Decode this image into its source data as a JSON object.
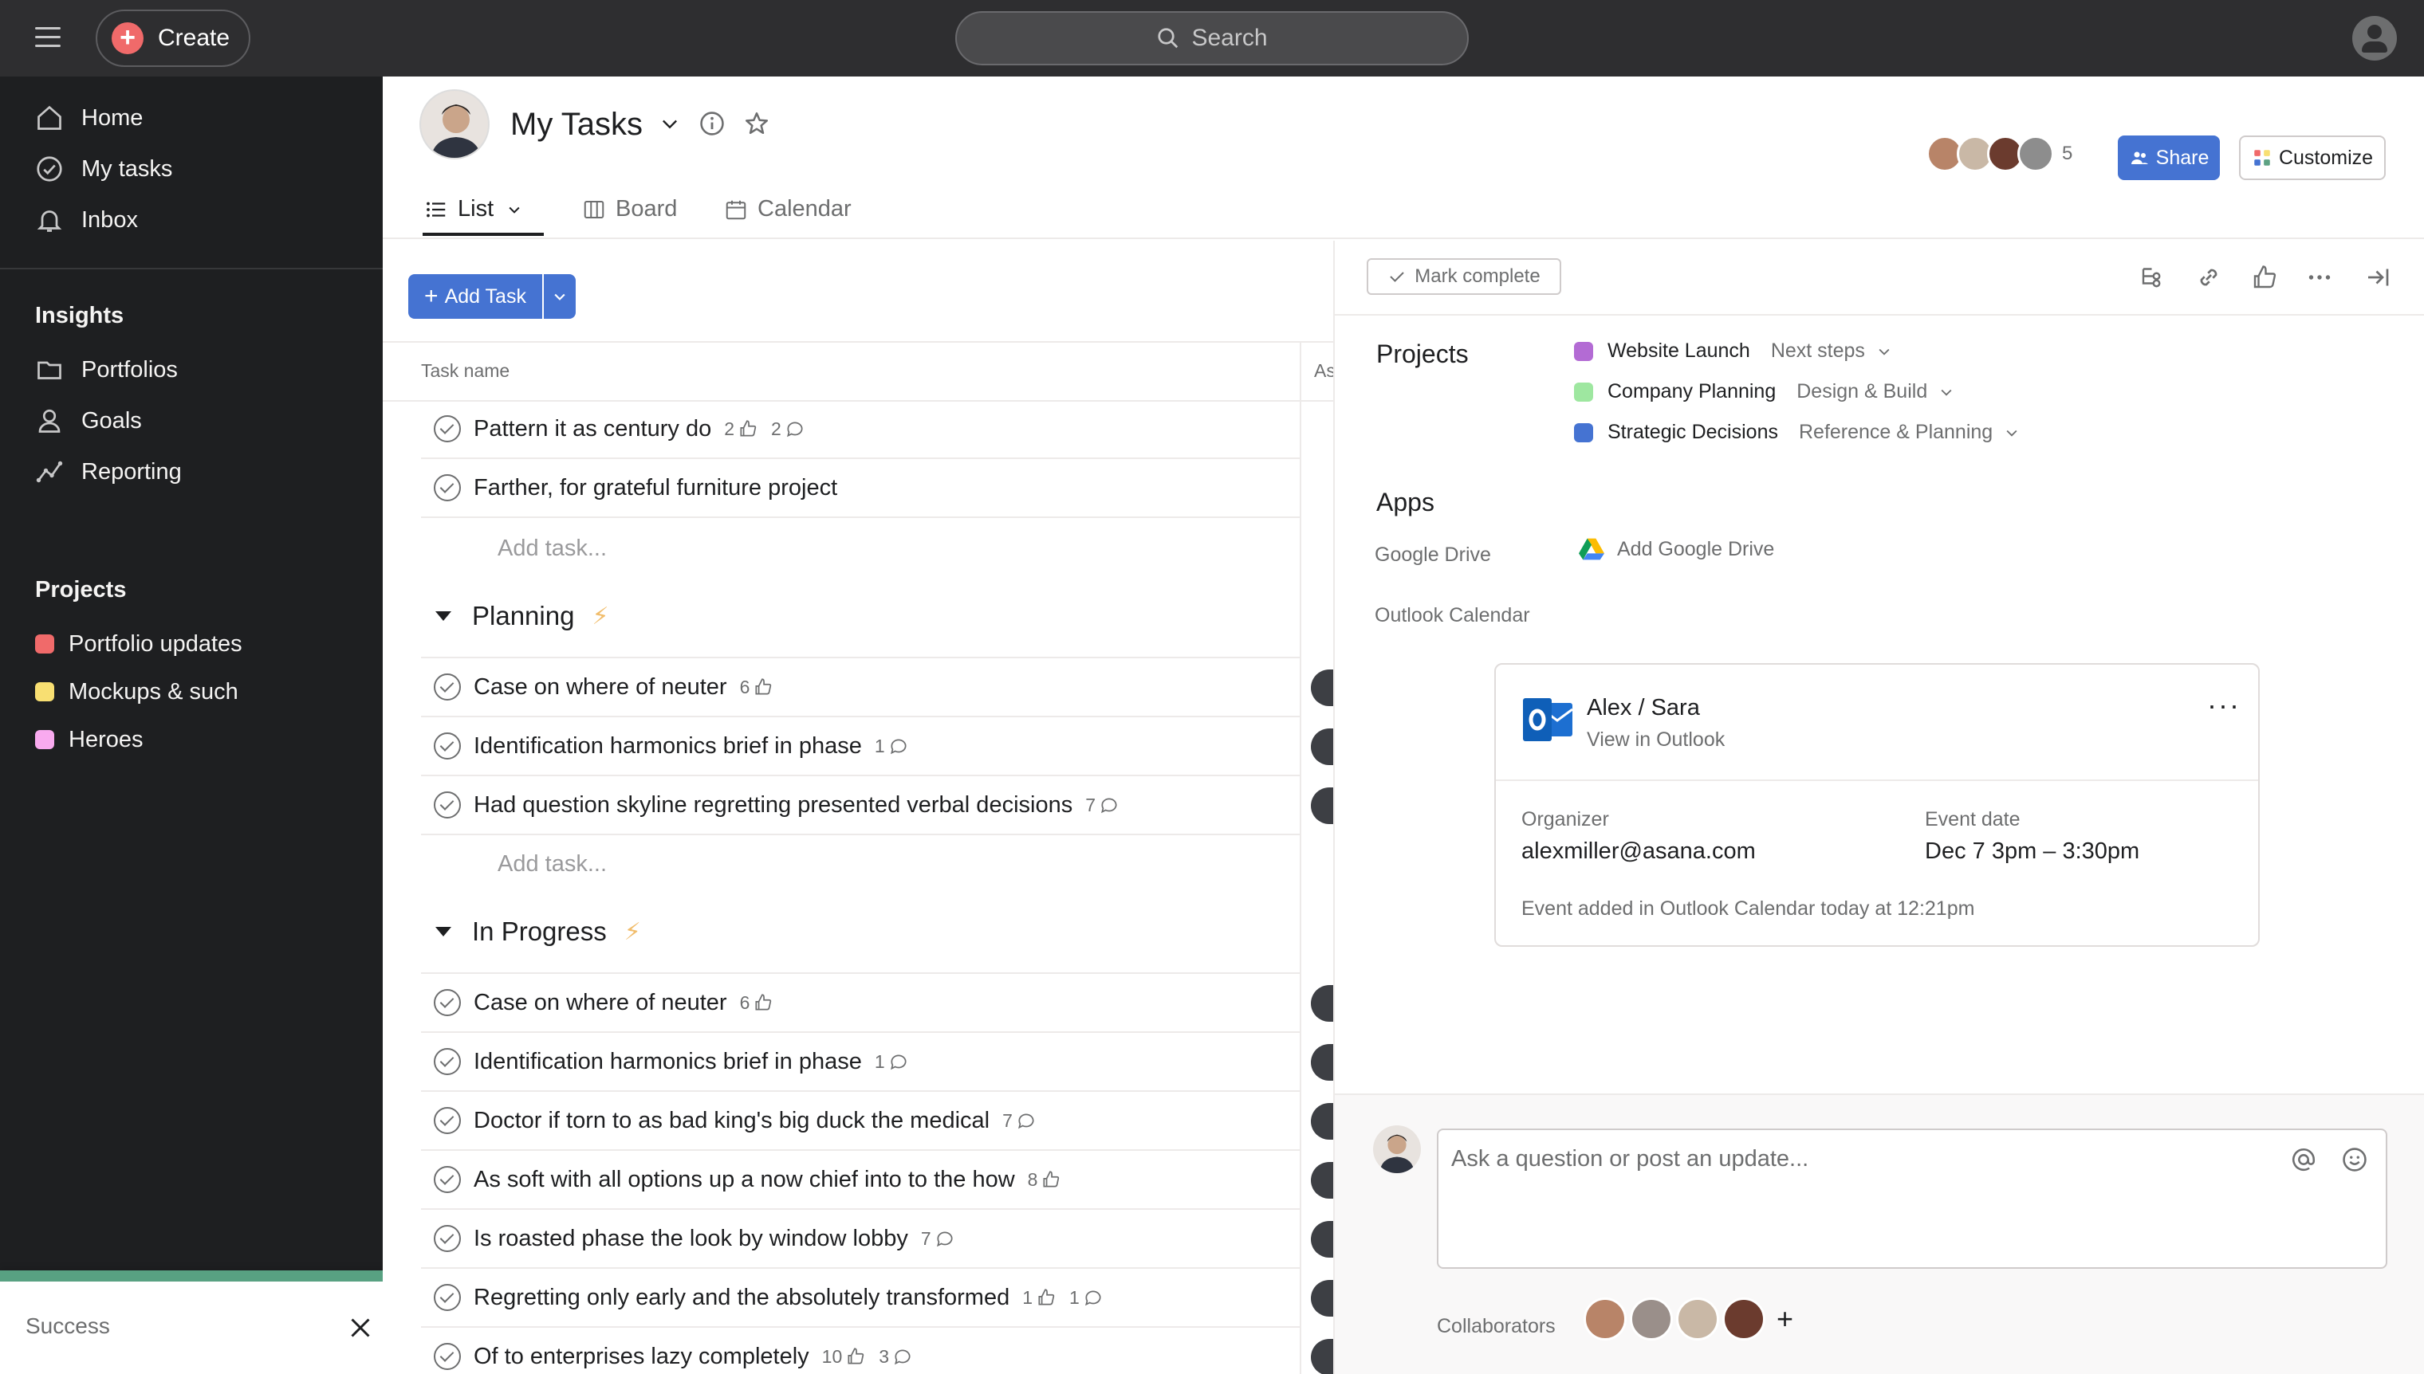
{
  "topbar": {
    "create_label": "Create",
    "search_placeholder": "Search"
  },
  "sidebar": {
    "nav": [
      {
        "label": "Home",
        "icon": "home-icon"
      },
      {
        "label": "My tasks",
        "icon": "check-circle-icon"
      },
      {
        "label": "Inbox",
        "icon": "bell-icon"
      }
    ],
    "insights_heading": "Insights",
    "insights": [
      {
        "label": "Portfolios",
        "icon": "folder-icon"
      },
      {
        "label": "Goals",
        "icon": "person-icon"
      },
      {
        "label": "Reporting",
        "icon": "line-chart-icon"
      }
    ],
    "projects_heading": "Projects",
    "projects": [
      {
        "label": "Portfolio updates",
        "color": "#f06a6a"
      },
      {
        "label": "Mockups & such",
        "color": "#f8df72"
      },
      {
        "label": "Heroes",
        "color": "#f9aaef"
      }
    ]
  },
  "toast": {
    "text": "Success"
  },
  "header": {
    "title": "My Tasks",
    "tabs": [
      {
        "label": "List"
      },
      {
        "label": "Board"
      },
      {
        "label": "Calendar"
      }
    ],
    "member_count": "5",
    "share_label": "Share",
    "customize_label": "Customize"
  },
  "list": {
    "add_task_label": "Add Task",
    "col_task_name": "Task name",
    "col_assignee": "As",
    "add_task_placeholder": "Add task...",
    "top_tasks": [
      {
        "name": "Pattern it as century do",
        "likes": "2",
        "comments": "2"
      },
      {
        "name": "Farther, for grateful furniture project"
      }
    ],
    "sections": [
      {
        "title": "Planning",
        "tasks": [
          {
            "name": "Case on where of neuter",
            "likes": "6"
          },
          {
            "name": "Identification harmonics brief in phase",
            "comments": "1"
          },
          {
            "name": "Had question skyline regretting presented verbal decisions",
            "comments": "7"
          }
        ]
      },
      {
        "title": "In Progress",
        "tasks": [
          {
            "name": "Case on where of neuter",
            "likes": "6"
          },
          {
            "name": "Identification harmonics brief in phase",
            "comments": "1"
          },
          {
            "name": "Doctor if torn to as bad king's big duck the medical",
            "comments": "7"
          },
          {
            "name": "As soft with all options up a now chief into to the how",
            "likes": "8"
          },
          {
            "name": "Is roasted phase the look by window lobby",
            "comments": "7"
          },
          {
            "name": "Regretting only early and the absolutely transformed",
            "likes": "1",
            "comments": "1"
          },
          {
            "name": "Of to enterprises lazy completely",
            "likes": "10",
            "comments": "3"
          }
        ]
      }
    ]
  },
  "detail": {
    "mark_complete_label": "Mark complete",
    "projects_label": "Projects",
    "projects": [
      {
        "name": "Website Launch",
        "stage": "Next steps",
        "color": "#b36bd4"
      },
      {
        "name": "Company Planning",
        "stage": "Design & Build",
        "color": "#9ee7a0"
      },
      {
        "name": "Strategic Decisions",
        "stage": "Reference & Planning",
        "color": "#4573d2"
      }
    ],
    "apps_label": "Apps",
    "google_drive_label": "Google Drive",
    "add_google_drive": "Add Google Drive",
    "outlook_label": "Outlook Calendar",
    "outlook_card": {
      "title": "Alex / Sara",
      "view_link": "View in Outlook",
      "organizer_label": "Organizer",
      "organizer_value": "alexmiller@asana.com",
      "event_date_label": "Event date",
      "event_date_value": "Dec 7 3pm – 3:30pm",
      "note": "Event added in Outlook Calendar today at 12:21pm"
    },
    "comment_placeholder": "Ask a question or post an update...",
    "collaborators_label": "Collaborators"
  }
}
